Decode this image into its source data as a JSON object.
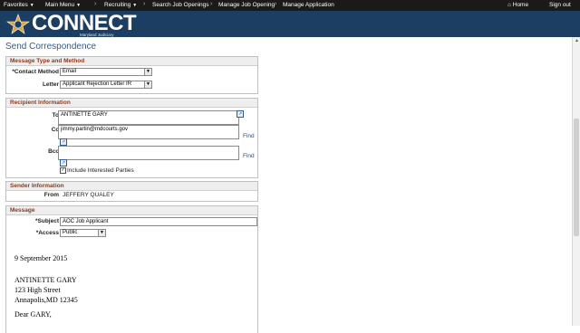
{
  "topnav": {
    "favorites": "Favorites",
    "main_menu": "Main Menu",
    "breadcrumbs": [
      "Recruiting",
      "Search Job Openings",
      "Manage Job Opening",
      "Manage Application"
    ],
    "home": "Home",
    "sign_out": "Sign out"
  },
  "brand": {
    "name": "CONNECT",
    "sub": "Maryland Judiciary"
  },
  "page": {
    "title": "Send Correspondence"
  },
  "message_type": {
    "header": "Message Type and Method",
    "contact_label": "*Contact Method",
    "contact_value": "Email",
    "letter_label": "Letter",
    "letter_value": "Applicant Rejection Letter IR"
  },
  "recipient": {
    "header": "Recipient Information",
    "to_label": "To",
    "to_value": "ANTINETTE GARY",
    "cc_label": "Cc",
    "cc_value": "jimmy.partin@mdcourts.gov",
    "bcc_label": "Bcc",
    "bcc_value": "",
    "find_label": "Find",
    "include_label": "Include Interested Parties"
  },
  "sender": {
    "header": "Sender Information",
    "from_label": "From",
    "from_value": "JEFFERY QUALEY"
  },
  "message": {
    "header": "Message",
    "subject_label": "*Subject",
    "subject_value": "AOC Job Applicant",
    "access_label": "*Access",
    "access_value": "Public",
    "letter_date": "9 September 2015",
    "address_name": "ANTINETTE GARY",
    "address_street": "123 High Street",
    "address_city": "Annapolis,MD 12345",
    "greeting": "Dear  GARY,"
  },
  "colors": {
    "topnav_bg": "#1a1a1a",
    "brand_bg": "#1c3e63",
    "title_blue": "#2f5b94",
    "section_header_text": "#8a3a1e"
  },
  "icons": [
    "star-icon",
    "home-icon",
    "lookup-icon",
    "checkbox-icon"
  ]
}
